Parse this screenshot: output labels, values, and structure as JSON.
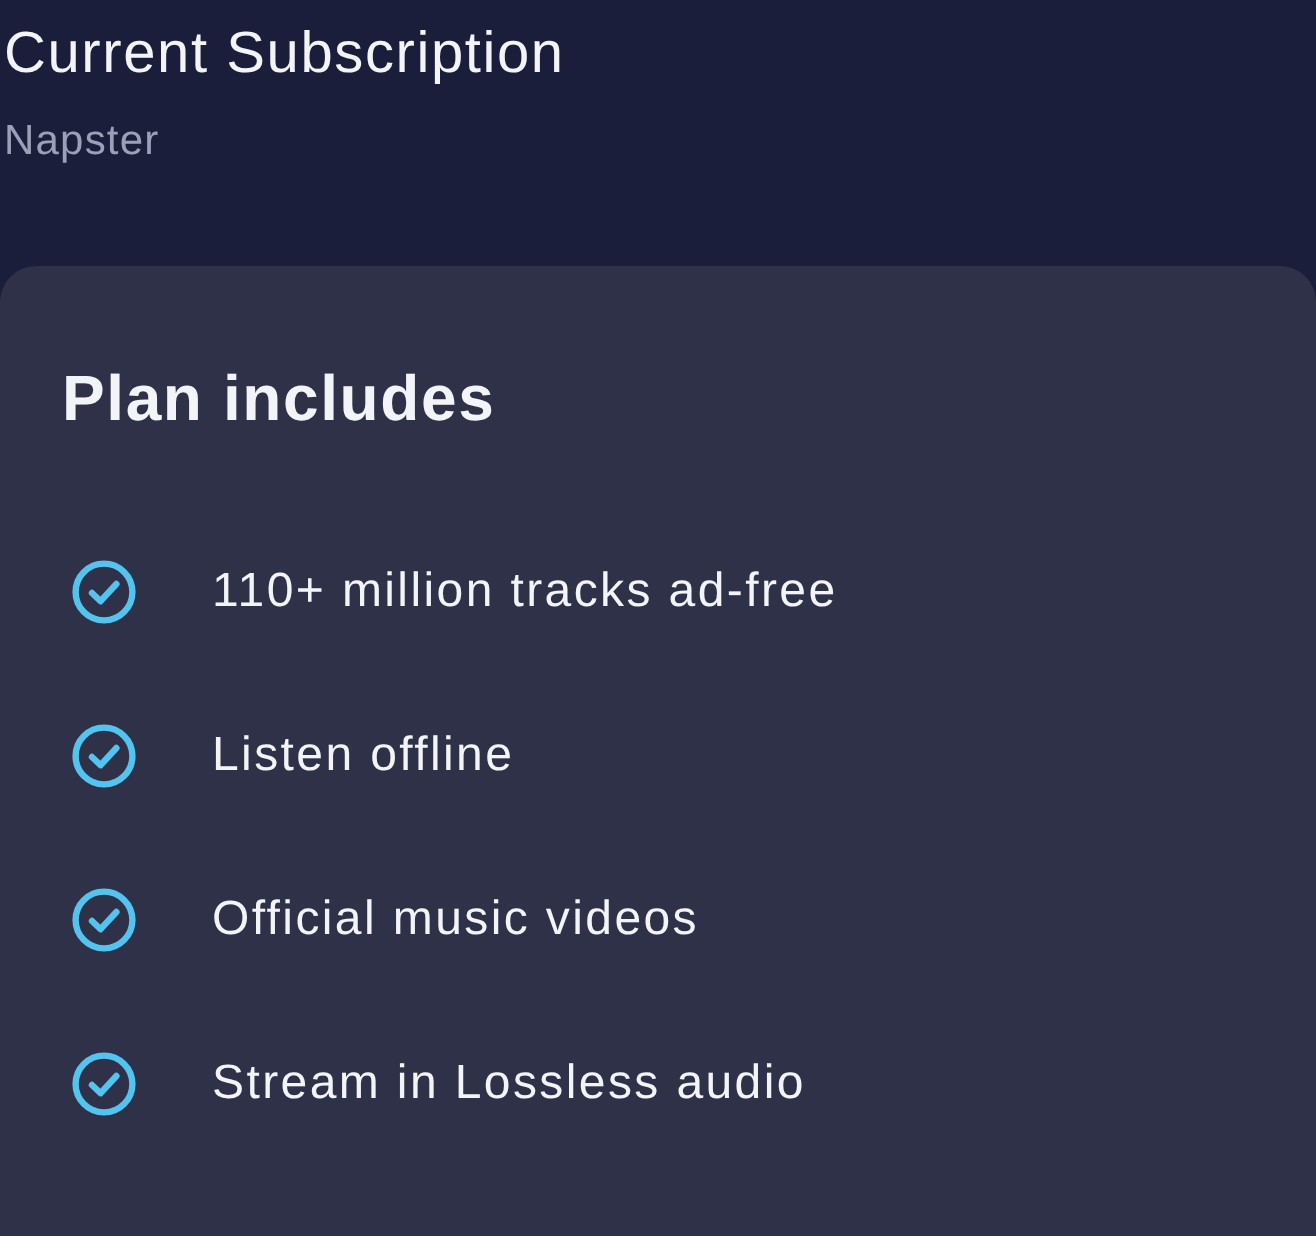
{
  "header": {
    "title": "Current Subscription",
    "subtitle": "Napster"
  },
  "plan_card": {
    "title": "Plan includes",
    "features": [
      "110+ million tracks ad-free",
      "Listen offline",
      "Official music videos",
      "Stream in Lossless audio"
    ]
  }
}
